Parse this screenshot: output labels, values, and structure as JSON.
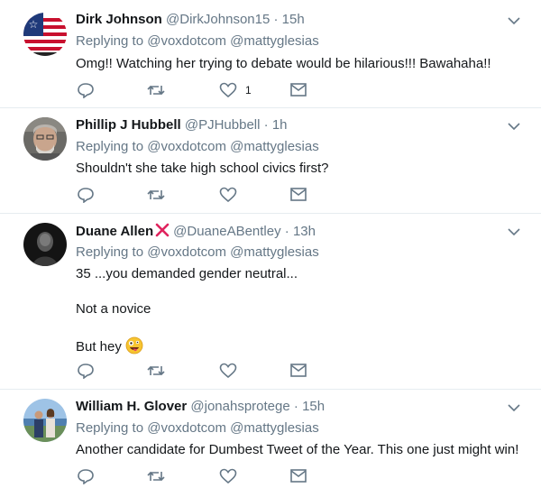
{
  "tweets": [
    {
      "name": "Dirk Johnson",
      "handle": "@DirkJohnson15",
      "dot": "·",
      "time": "15h",
      "reply_to": "Replying to @voxdotcom @mattyglesias",
      "lines": [
        "Omg!!  Watching her trying to debate would be hilarious!!!  Bawahaha!!"
      ],
      "likes": "1"
    },
    {
      "name": "Phillip J Hubbell",
      "handle": "@PJHubbell",
      "dot": "·",
      "time": "1h",
      "reply_to": "Replying to @voxdotcom @mattyglesias",
      "lines": [
        "Shouldn't she take high school civics first?"
      ]
    },
    {
      "name": "Duane Allen",
      "handle": "@DuaneABentley",
      "dot": "·",
      "time": "13h",
      "reply_to": "Replying to @voxdotcom @mattyglesias",
      "lines": [
        "35 ...you demanded gender neutral...",
        "Not a novice",
        "But hey"
      ]
    },
    {
      "name": "William H. Glover",
      "handle": "@jonahsprotege",
      "dot": "·",
      "time": "15h",
      "reply_to": "Replying to @voxdotcom @mattyglesias",
      "lines": [
        "Another candidate for Dumbest Tweet of the Year. This one just might win!"
      ]
    }
  ],
  "icons": {
    "reply": "reply-icon",
    "retweet": "retweet-icon",
    "like": "heart-icon",
    "dm": "direct-message-icon",
    "more": "chevron-down-icon"
  },
  "colors": {
    "icon": "#657786",
    "divider": "#e6ecf0",
    "x_mark": "#e0245e"
  }
}
